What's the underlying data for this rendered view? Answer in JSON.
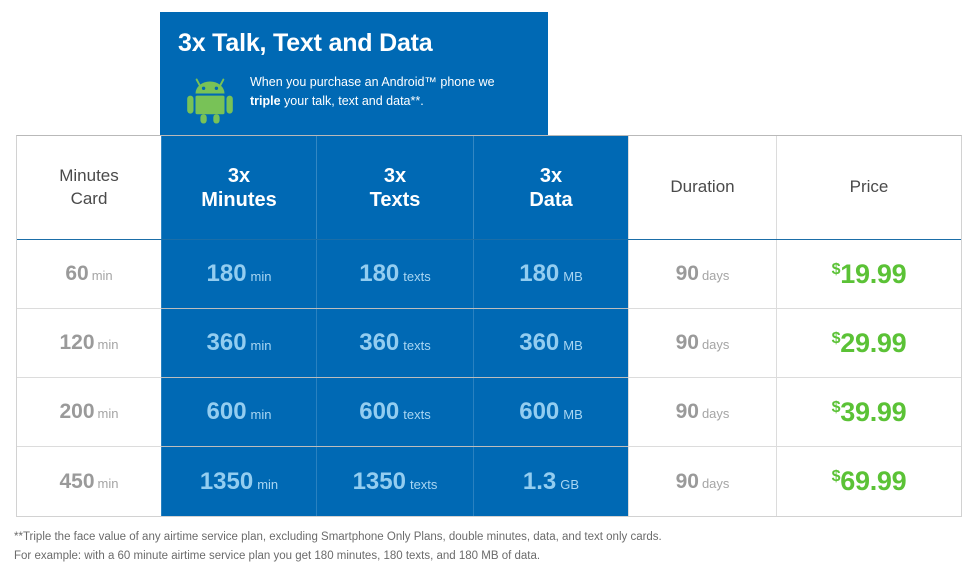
{
  "promo": {
    "title": "3x Talk, Text and Data",
    "icon": "android-robot-icon",
    "body_line1_prefix": "When you purchase an Android™ phone we",
    "body_bold": "triple",
    "body_line2_suffix": " your talk, text and data**.",
    "colors": {
      "banner_blue": "#0069b4",
      "android_green": "#78c257"
    }
  },
  "table": {
    "columns": [
      {
        "key": "card",
        "label_line1": "Minutes",
        "label_line2": "Card",
        "style": "plain"
      },
      {
        "key": "minutes",
        "label_line1": "3x",
        "label_line2": "Minutes",
        "style": "blue"
      },
      {
        "key": "texts",
        "label_line1": "3x",
        "label_line2": "Texts",
        "style": "blue"
      },
      {
        "key": "data",
        "label_line1": "3x",
        "label_line2": "Data",
        "style": "blue"
      },
      {
        "key": "duration",
        "label_line1": "Duration",
        "label_line2": "",
        "style": "plain"
      },
      {
        "key": "price",
        "label_line1": "Price",
        "label_line2": "",
        "style": "plain"
      }
    ],
    "rows": [
      {
        "card_value": "60",
        "card_unit": "min",
        "minutes_value": "180",
        "minutes_unit": "min",
        "texts_value": "180",
        "texts_unit": "texts",
        "data_value": "180",
        "data_unit": "MB",
        "duration_value": "90",
        "duration_unit": "days",
        "price_currency": "$",
        "price_amount": "19.99"
      },
      {
        "card_value": "120",
        "card_unit": "min",
        "minutes_value": "360",
        "minutes_unit": "min",
        "texts_value": "360",
        "texts_unit": "texts",
        "data_value": "360",
        "data_unit": "MB",
        "duration_value": "90",
        "duration_unit": "days",
        "price_currency": "$",
        "price_amount": "29.99"
      },
      {
        "card_value": "200",
        "card_unit": "min",
        "minutes_value": "600",
        "minutes_unit": "min",
        "texts_value": "600",
        "texts_unit": "texts",
        "data_value": "600",
        "data_unit": "MB",
        "duration_value": "90",
        "duration_unit": "days",
        "price_currency": "$",
        "price_amount": "39.99"
      },
      {
        "card_value": "450",
        "card_unit": "min",
        "minutes_value": "1350",
        "minutes_unit": "min",
        "texts_value": "1350",
        "texts_unit": "texts",
        "data_value": "1.3",
        "data_unit": "GB",
        "duration_value": "90",
        "duration_unit": "days",
        "price_currency": "$",
        "price_amount": "69.99"
      }
    ],
    "colors": {
      "highlight_blue": "#0069b4",
      "value_on_blue": "#93cdf0",
      "value_grey": "#9a9a9a",
      "price_green": "#5bc236",
      "border_grey": "#dcdcdc"
    }
  },
  "footnotes": [
    "**Triple the face value of any airtime service plan, excluding Smartphone Only Plans, double minutes, data, and text only cards.",
    "For example: with a 60 minute airtime service plan you get 180 minutes, 180 texts, and 180 MB of data."
  ]
}
